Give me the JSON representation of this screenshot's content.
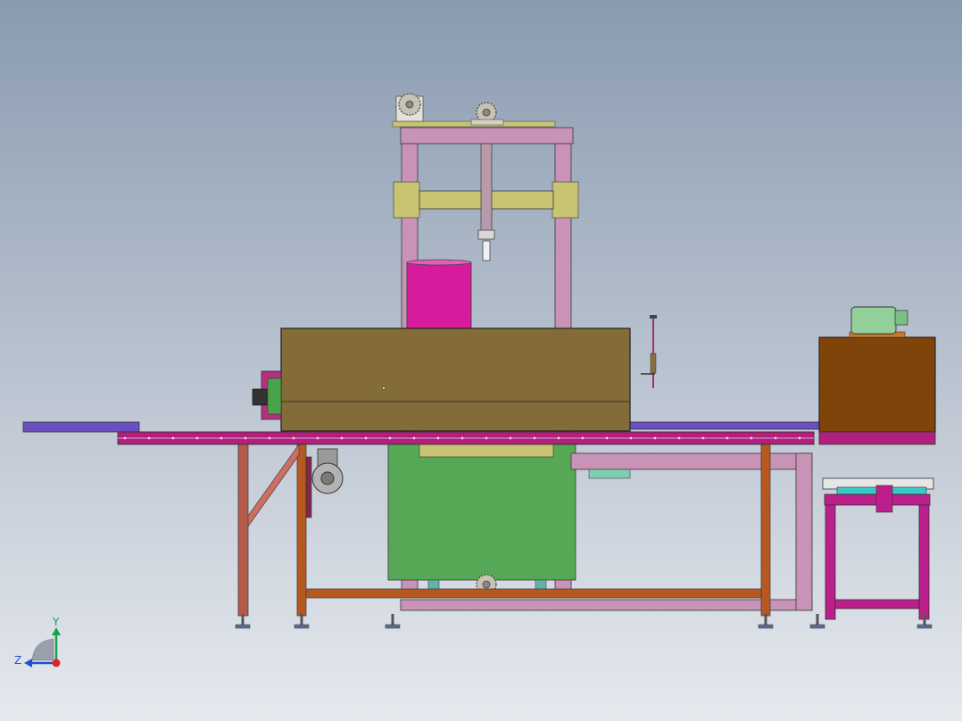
{
  "viewport": {
    "background_top": "#8a9bb0",
    "background_bottom": "#e6e9ee"
  },
  "triad": {
    "y_label": "Y",
    "z_label": "Z",
    "y_color": "#16a34a",
    "z_color": "#1d4ed8",
    "origin_color": "#dc2626"
  },
  "colors": {
    "frame_pink": "#c893b6",
    "cross_beam": "#c9c472",
    "oven_body": "#836c38",
    "drum": "#d61c9c",
    "conveyor_rail": "#b0207c",
    "conveyor_belt": "#6a4fc0",
    "hopper_green": "#56a756",
    "orange_frame": "#b7581f",
    "right_box": "#7e4409",
    "motor_green": "#92cf9a",
    "table_magenta": "#bb1f8c",
    "table_top_cyan": "#38c9c6",
    "red_leg": "#b65a4a",
    "sprocket": "#c8c2b3"
  }
}
